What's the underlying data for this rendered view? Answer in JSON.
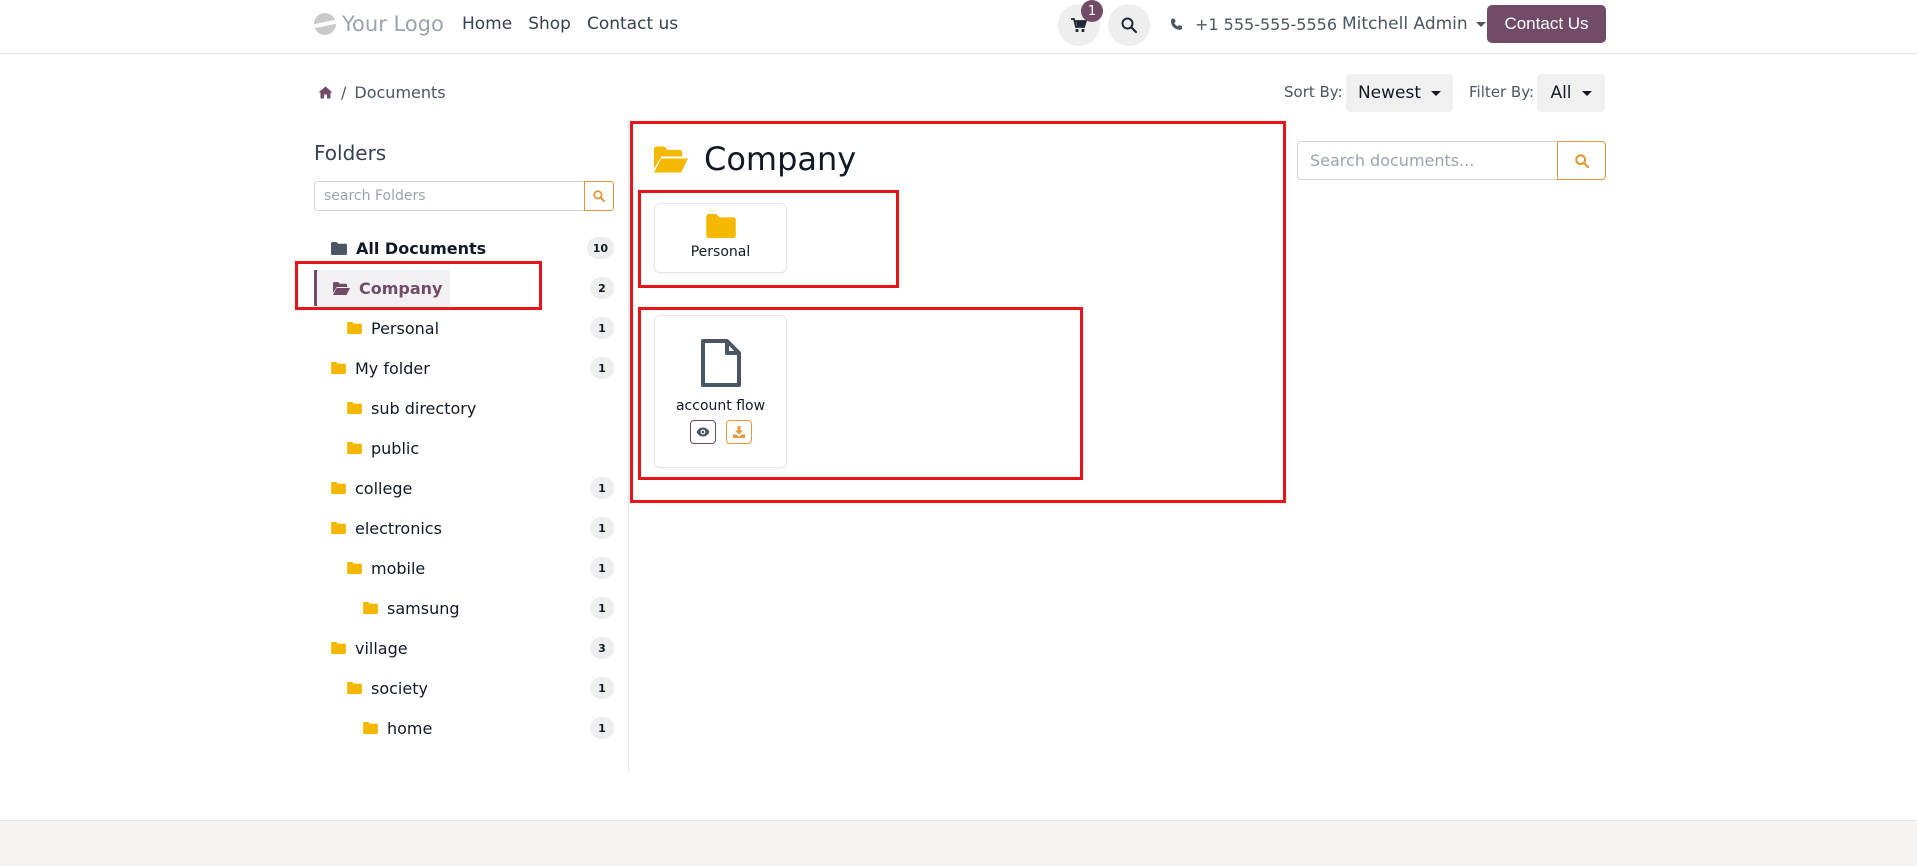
{
  "header": {
    "logo_text": "Your Logo",
    "nav": [
      "Home",
      "Shop",
      "Contact us"
    ],
    "cart_count": "1",
    "phone": "+1 555-555-5556",
    "user_name": "Mitchell Admin",
    "contact_button": "Contact Us"
  },
  "breadcrumb": {
    "current": "Documents"
  },
  "toolbar": {
    "sort_label": "Sort By:",
    "sort_value": "Newest",
    "filter_label": "Filter By:",
    "filter_value": "All"
  },
  "sidebar": {
    "title": "Folders",
    "search_placeholder": "search Folders",
    "items": [
      {
        "label": "All Documents",
        "count": "10"
      },
      {
        "label": "Company",
        "count": "2"
      },
      {
        "label": "Personal",
        "count": "1"
      },
      {
        "label": "My folder",
        "count": "1"
      },
      {
        "label": "sub directory",
        "count": ""
      },
      {
        "label": "public",
        "count": ""
      },
      {
        "label": "college",
        "count": "1"
      },
      {
        "label": "electronics",
        "count": "1"
      },
      {
        "label": "mobile",
        "count": "1"
      },
      {
        "label": "samsung",
        "count": "1"
      },
      {
        "label": "village",
        "count": "3"
      },
      {
        "label": "society",
        "count": "1"
      },
      {
        "label": "home",
        "count": "1"
      }
    ]
  },
  "main": {
    "folder_title": "Company",
    "subfolders": [
      {
        "label": "Personal"
      }
    ],
    "documents": [
      {
        "label": "account flow"
      }
    ],
    "search_placeholder": "Search documents..."
  },
  "colors": {
    "brand": "#714b67",
    "folder": "#f5b800",
    "accent": "#e09a3a",
    "highlight": "#e8141b"
  }
}
